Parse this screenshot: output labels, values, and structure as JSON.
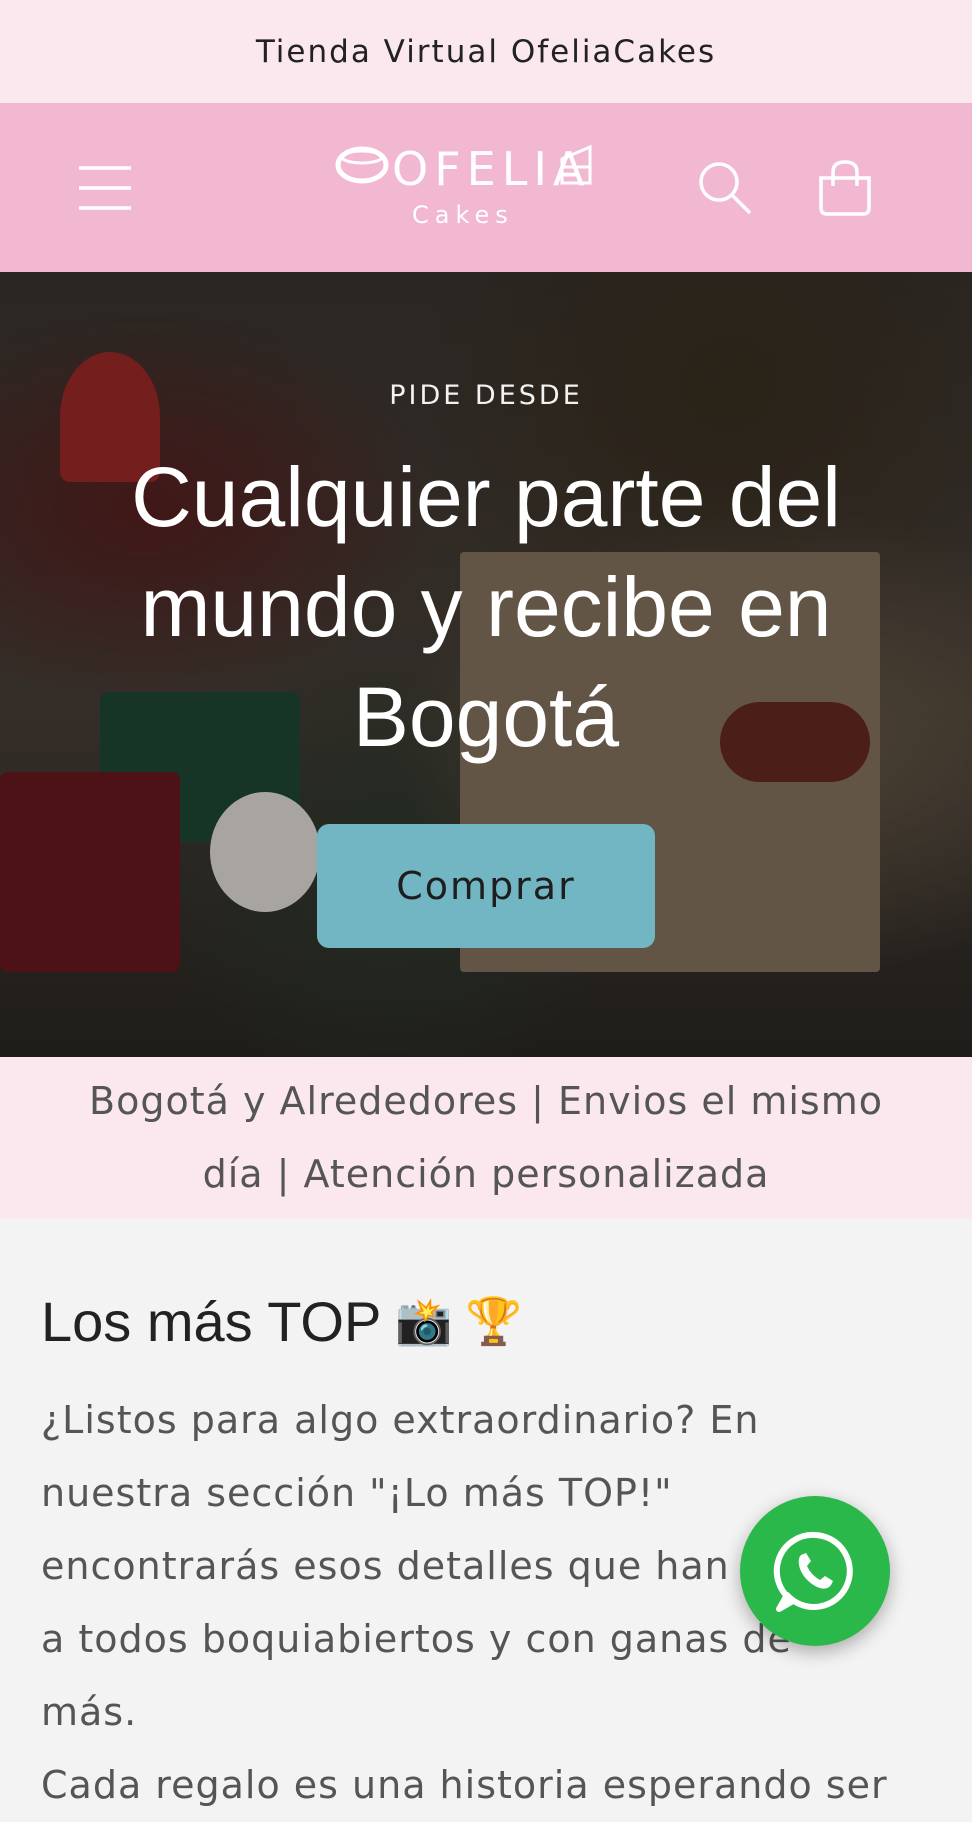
{
  "announcement": {
    "text": "Tienda Virtual OfeliaCakes"
  },
  "header": {
    "logo_main": "OFELIA",
    "logo_sub": "Cakes",
    "menu_icon": "hamburger-menu-icon",
    "search_icon": "search-icon",
    "cart_icon": "cart-icon"
  },
  "hero": {
    "eyebrow": "PIDE DESDE",
    "title": "Cualquier parte del mundo y recibe en Bogotá",
    "button_label": "Comprar"
  },
  "info_bar": {
    "text": "Bogotá y Alrededores | Envios el mismo día | Atención personalizada"
  },
  "top_section": {
    "title": "Los más TOP",
    "title_emojis": "📸 🏆",
    "text": "¿Listos para algo extraordinario? En nuestra sección \"¡Lo más TOP!\" encontrarás esos detalles que han dejado a todos boquiabiertos y con ganas de más.",
    "text2": "Cada regalo es una historia esperando ser"
  },
  "whatsapp": {
    "icon": "whatsapp-icon"
  },
  "colors": {
    "announcement_bg": "#fbe8ef",
    "header_bg": "#f2b8d2",
    "button_bg": "#72b6c4",
    "whatsapp_green": "#2bb84a"
  }
}
